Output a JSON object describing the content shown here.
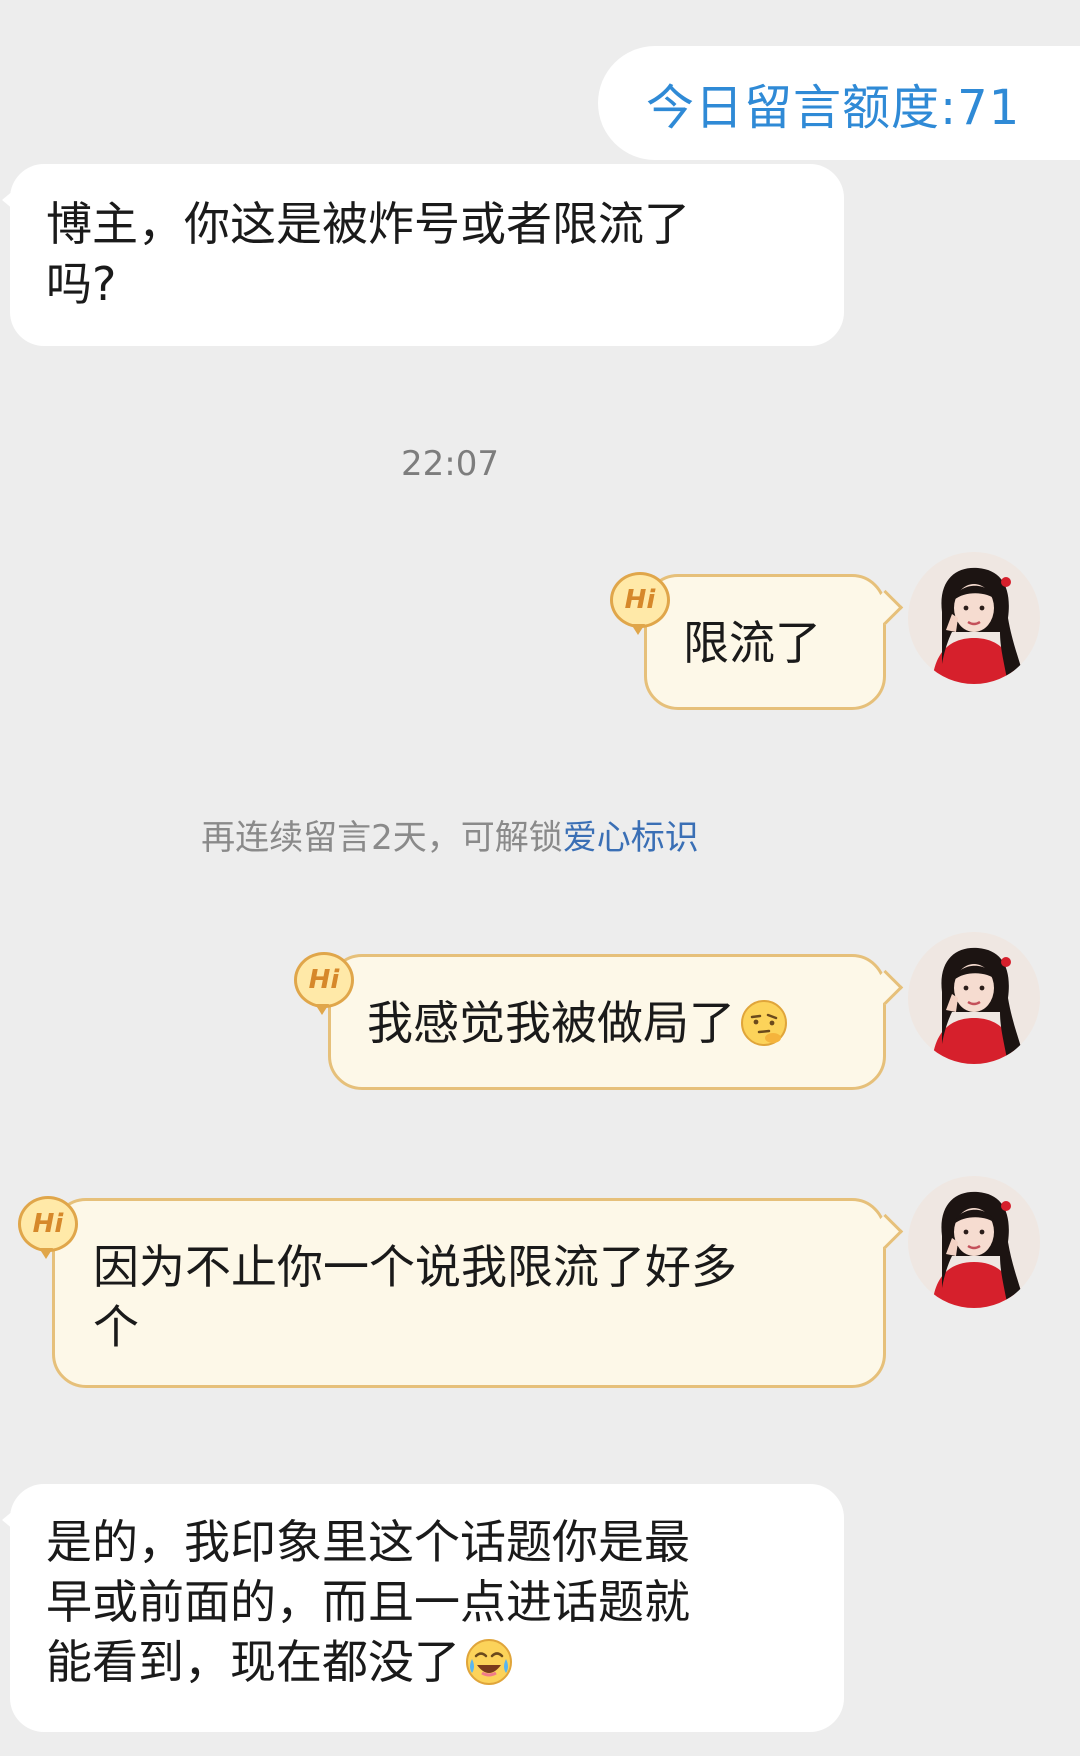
{
  "quota": {
    "label": "今日留言额度:71"
  },
  "messages": {
    "m1": {
      "text": "博主，你这是被炸号或者限流了\n吗?"
    },
    "timestamp": "22:07",
    "m2": {
      "text": "限流了",
      "badge": "Hi"
    },
    "notice": {
      "prefix": "再连续留言2天，可解锁",
      "link": "爱心标识"
    },
    "m3": {
      "text": "我感觉我被做局了",
      "badge": "Hi",
      "emoji": "thinking-face"
    },
    "m4": {
      "text": "因为不止你一个说我限流了好多\n个",
      "badge": "Hi"
    },
    "m5": {
      "text": "是的，我印象里这个话题你是最\n早或前面的，而且一点进话题就\n能看到，现在都没了",
      "emoji": "crying-laughing-face"
    }
  },
  "colors": {
    "background": "#ededed",
    "quota_text": "#2f8ad6",
    "notice_link": "#3a6fb5",
    "outgoing_bubble": "#fdf8e8",
    "outgoing_border": "#e6c07a"
  }
}
